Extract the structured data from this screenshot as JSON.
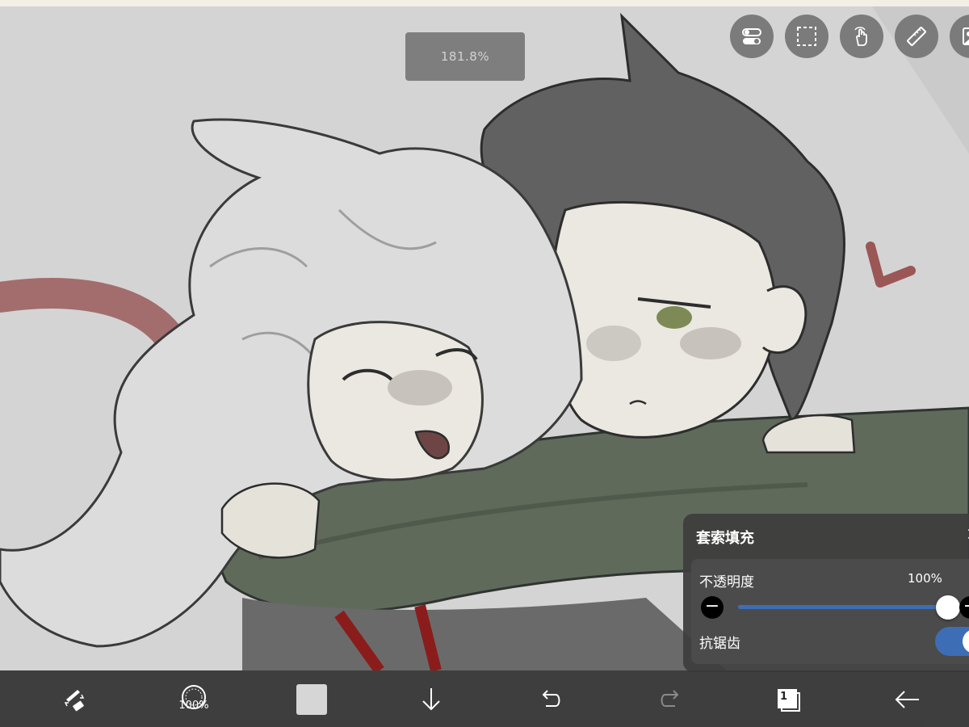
{
  "canvas": {
    "zoom_label": "181.8%",
    "background": "#d4d4d4"
  },
  "top_tools": [
    {
      "name": "toggle-tools-icon"
    },
    {
      "name": "selection-icon"
    },
    {
      "name": "touch-gesture-icon"
    },
    {
      "name": "ruler-icon"
    },
    {
      "name": "material-icon"
    }
  ],
  "fill_panel": {
    "title": "套索填充",
    "opacity_label": "不透明度",
    "opacity_value": "100%",
    "opacity": 1.0,
    "antialias_label": "抗锯齿",
    "antialias_on": true,
    "accent_color": "#3d6eb5"
  },
  "bottom_bar": {
    "brush_size_label": "100%",
    "current_color": "#d6d6d6",
    "layer_count": "1",
    "items": [
      "brush-eraser-swap-icon",
      "brush-size-icon",
      "color-swatch",
      "download-icon",
      "undo-icon",
      "redo-icon",
      "layers-icon",
      "back-arrow-icon"
    ]
  }
}
